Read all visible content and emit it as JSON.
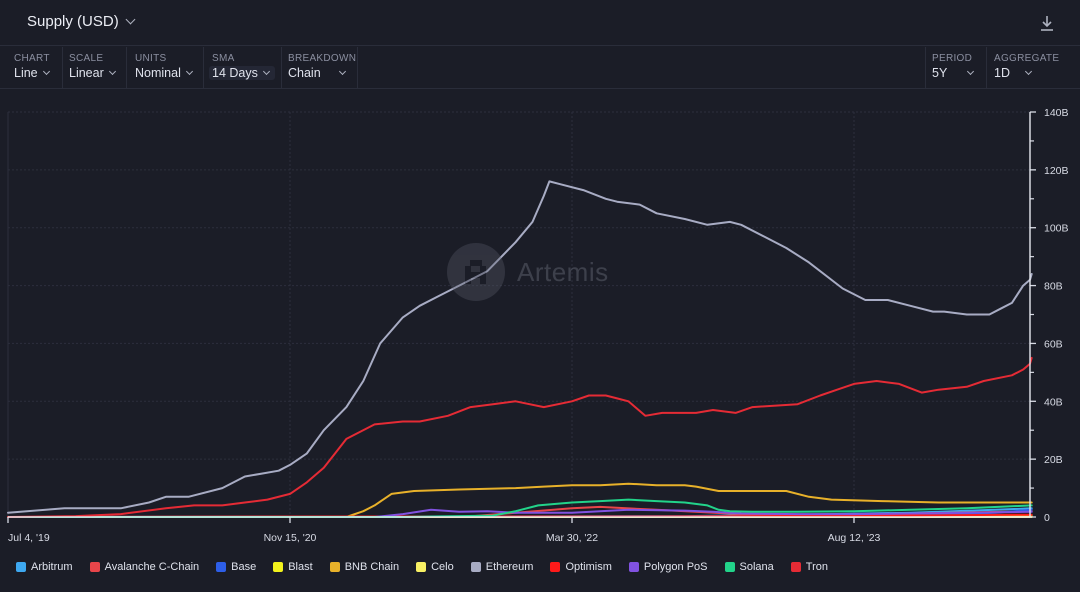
{
  "header": {
    "title": "Supply (USD)",
    "download_icon": "download-icon"
  },
  "toolbar": {
    "controls": [
      {
        "label": "CHART",
        "value": "Line"
      },
      {
        "label": "SCALE",
        "value": "Linear"
      },
      {
        "label": "UNITS",
        "value": "Nominal"
      },
      {
        "label": "SMA",
        "value": "14 Days"
      },
      {
        "label": "BREAKDOWN",
        "value": "Chain"
      },
      {
        "label": "PERIOD",
        "value": "5Y"
      },
      {
        "label": "AGGREGATE",
        "value": "1D"
      }
    ]
  },
  "watermark": "Artemis",
  "chart_data": {
    "type": "line",
    "title": "Supply (USD)",
    "xlabel": "",
    "ylabel": "",
    "x_ticks": [
      "Jul 4, '19",
      "Nov 15, '20",
      "Mar 30, '22",
      "Aug 12, '23"
    ],
    "x_tick_days": [
      0,
      500,
      1000,
      1500
    ],
    "x_range_days": [
      0,
      1815
    ],
    "y_ticks": [
      "0",
      "20B",
      "40B",
      "60B",
      "80B",
      "100B",
      "120B",
      "140B"
    ],
    "ylim": [
      0,
      140
    ],
    "y_unit": "B",
    "grid": true,
    "legend_position": "bottom",
    "series": [
      {
        "name": "Arbitrum",
        "color": "#3ea8f0",
        "x": [
          0,
          1200,
          1400,
          1600,
          1750,
          1815
        ],
        "y": [
          0,
          0.3,
          0.8,
          1.5,
          2.5,
          3
        ]
      },
      {
        "name": "Avalanche C-Chain",
        "color": "#e8454a",
        "x": [
          0,
          820,
          900,
          1000,
          1050,
          1150,
          1300,
          1500,
          1815
        ],
        "y": [
          0,
          0.2,
          1.5,
          3.0,
          3.5,
          2.5,
          1.0,
          0.8,
          2.0
        ]
      },
      {
        "name": "Base",
        "color": "#2d5ee8",
        "x": [
          0,
          1450,
          1600,
          1750,
          1815
        ],
        "y": [
          0,
          0,
          0.5,
          1.5,
          2.5
        ]
      },
      {
        "name": "Blast",
        "color": "#f2f21c",
        "x": [
          0,
          1650,
          1815
        ],
        "y": [
          0,
          0,
          0.3
        ]
      },
      {
        "name": "BNB Chain",
        "color": "#e8b12a",
        "x": [
          0,
          600,
          630,
          650,
          680,
          720,
          800,
          900,
          950,
          1000,
          1050,
          1100,
          1150,
          1200,
          1220,
          1260,
          1320,
          1380,
          1420,
          1460,
          1550,
          1650,
          1750,
          1815
        ],
        "y": [
          0,
          0,
          2,
          4,
          8,
          9,
          9.5,
          10,
          10.5,
          11,
          11,
          11.5,
          11,
          11,
          10.5,
          9,
          9,
          9,
          7,
          6,
          5.5,
          5,
          5,
          5
        ]
      },
      {
        "name": "Celo",
        "color": "#f8f064",
        "x": [
          0,
          1815
        ],
        "y": [
          0,
          0
        ]
      },
      {
        "name": "Ethereum",
        "color": "#a8acc4",
        "x": [
          0,
          100,
          200,
          250,
          280,
          320,
          380,
          420,
          450,
          480,
          500,
          530,
          560,
          600,
          630,
          660,
          700,
          730,
          760,
          800,
          850,
          900,
          930,
          950,
          960,
          980,
          1020,
          1060,
          1080,
          1120,
          1150,
          1200,
          1240,
          1280,
          1300,
          1340,
          1380,
          1420,
          1480,
          1520,
          1560,
          1600,
          1640,
          1660,
          1700,
          1740,
          1760,
          1780,
          1800,
          1812,
          1815
        ],
        "y": [
          1.5,
          3,
          3,
          5,
          7,
          7,
          10,
          14,
          15,
          16,
          18,
          22,
          30,
          38,
          47,
          60,
          69,
          73,
          76,
          80,
          85,
          95,
          102,
          111,
          116,
          115,
          113,
          110,
          109,
          108,
          105,
          103,
          101,
          102,
          101,
          97,
          93,
          88,
          79,
          75,
          75,
          73,
          71,
          71,
          70,
          70,
          72,
          74,
          80,
          82,
          84,
          84,
          83,
          84,
          77
        ]
      },
      {
        "name": "Optimism",
        "color": "#ff1a1a",
        "x": [
          0,
          1200,
          1500,
          1815
        ],
        "y": [
          0,
          0.2,
          0.4,
          0.8
        ]
      },
      {
        "name": "Polygon PoS",
        "color": "#8152e0",
        "x": [
          0,
          650,
          700,
          750,
          800,
          850,
          900,
          1000,
          1100,
          1200,
          1250,
          1300,
          1400,
          1500,
          1600,
          1700,
          1815
        ],
        "y": [
          0,
          0,
          1.0,
          2.5,
          1.8,
          2.0,
          1.5,
          1.5,
          2.5,
          2.2,
          1.8,
          1.2,
          1.0,
          1.0,
          1.2,
          1.5,
          1.8
        ]
      },
      {
        "name": "Solana",
        "color": "#22d38a",
        "x": [
          0,
          700,
          860,
          900,
          940,
          1000,
          1050,
          1100,
          1150,
          1200,
          1240,
          1260,
          1280,
          1320,
          1400,
          1500,
          1600,
          1700,
          1815
        ],
        "y": [
          0,
          0,
          0.5,
          2,
          4,
          5,
          5.5,
          6,
          5.5,
          5,
          4,
          2.5,
          2,
          1.8,
          1.8,
          2,
          2.5,
          3,
          4
        ]
      },
      {
        "name": "Tron",
        "color": "#e52b35",
        "x": [
          0,
          120,
          200,
          280,
          330,
          380,
          420,
          460,
          500,
          530,
          560,
          580,
          600,
          650,
          700,
          730,
          780,
          820,
          860,
          900,
          950,
          1000,
          1030,
          1060,
          1080,
          1100,
          1130,
          1160,
          1220,
          1250,
          1290,
          1320,
          1400,
          1440,
          1470,
          1500,
          1540,
          1580,
          1620,
          1650,
          1700,
          1730,
          1780,
          1800,
          1812,
          1815
        ],
        "y": [
          0,
          0.3,
          1,
          3,
          4,
          4,
          5,
          6,
          8,
          12,
          17,
          22,
          27,
          32,
          33,
          33,
          35,
          38,
          39,
          40,
          38,
          40,
          42,
          42,
          41,
          40,
          35,
          36,
          36,
          37,
          36,
          38,
          39,
          42,
          44,
          46,
          47,
          46,
          43,
          44,
          45,
          47,
          49,
          51,
          53,
          55,
          57,
          58,
          59,
          59,
          55
        ]
      }
    ]
  }
}
